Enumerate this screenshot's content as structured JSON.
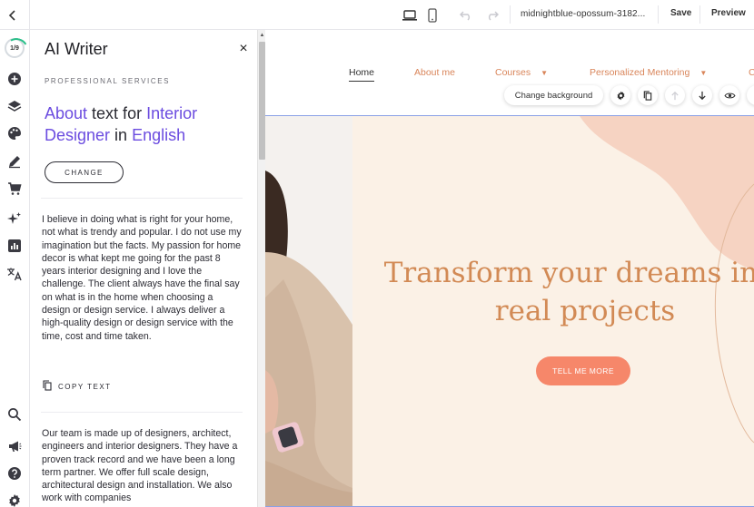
{
  "topbar": {
    "site_name": "midnightblue-opossum-3182...",
    "save_label": "Save",
    "preview_label": "Preview"
  },
  "rail": {
    "progress": "1/9",
    "items": [
      "add-icon",
      "layers-icon",
      "palette-icon",
      "pen-icon",
      "cart-icon",
      "sparkles-icon",
      "analytics-icon",
      "translate-icon",
      "search-icon",
      "megaphone-icon",
      "help-icon",
      "settings-icon"
    ]
  },
  "panel": {
    "title": "AI Writer",
    "close": "×",
    "category": "PROFESSIONAL SERVICES",
    "heading": {
      "part1": "About",
      "part2": " text for ",
      "part3": "Interior Designer",
      "part4": " in ",
      "part5": "English"
    },
    "change_label": "CHANGE",
    "paragraph1": "I believe in doing what is right for your home, not what is trendy and popular. I do not use my imagination but the facts. My passion for home decor is what kept me going for the past 8 years interior designing and I love the challenge. The client always have the final say on what is in the home when choosing a design or design service. I always deliver a high-quality design or design service with the time, cost and time taken.",
    "copy_label": "COPY TEXT",
    "paragraph2": "Our team is made up of designers, architect, engineers and interior designers. They have a proven track record and we have been a long term partner. We offer full scale design, architectural design and installation. We also work with companies"
  },
  "site": {
    "nav": [
      "Home",
      "About me",
      "Courses",
      "Personalized Mentoring",
      "C"
    ],
    "change_background": "Change background",
    "hero_title_line1": "Transform your dreams into",
    "hero_title_line2": "real projects",
    "cta": "TELL ME MORE"
  },
  "colors": {
    "accent_purple": "#6b4ce0",
    "nav_orange": "#d9855a",
    "hero_title": "#d28a55",
    "cta_bg": "#f6876a",
    "hero_bg": "#fbf1e6",
    "blob": "#f6d3c2"
  }
}
